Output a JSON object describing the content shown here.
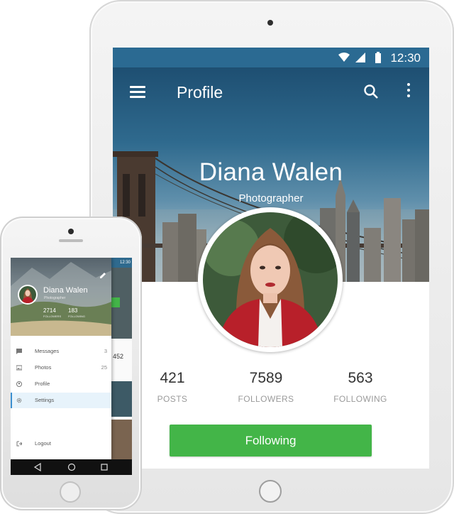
{
  "tablet": {
    "status": {
      "time": "12:30"
    },
    "toolbar": {
      "title": "Profile",
      "icons": [
        "menu-icon",
        "search-icon",
        "more-vert-icon"
      ]
    },
    "profile": {
      "name": "Diana Walen",
      "role": "Photographer"
    },
    "stats": [
      {
        "value": "421",
        "label": "POSTS"
      },
      {
        "value": "7589",
        "label": "FOLLOWERS"
      },
      {
        "value": "563",
        "label": "FOLLOWING"
      }
    ],
    "follow_button": "Following",
    "colors": {
      "status_bar": "#2b6a92",
      "button": "#43b548"
    }
  },
  "phone": {
    "status": {
      "time": "12:30"
    },
    "drawer": {
      "name": "Diana Walen",
      "role": "Photographer",
      "stats": [
        {
          "value": "2714",
          "label": "FOLLOWERS"
        },
        {
          "value": "183",
          "label": "FOLLOWING"
        }
      ],
      "items": [
        {
          "label": "Messages",
          "count": "3",
          "icon": "message-icon"
        },
        {
          "label": "Photos",
          "count": "25",
          "icon": "photo-icon"
        },
        {
          "label": "Profile",
          "count": "",
          "icon": "profile-icon"
        },
        {
          "label": "Settings",
          "count": "",
          "icon": "settings-icon"
        }
      ],
      "logout": "Logout"
    },
    "behind": {
      "value": "452"
    },
    "colors": {
      "selected_item_bg": "#e7f3fb"
    }
  }
}
